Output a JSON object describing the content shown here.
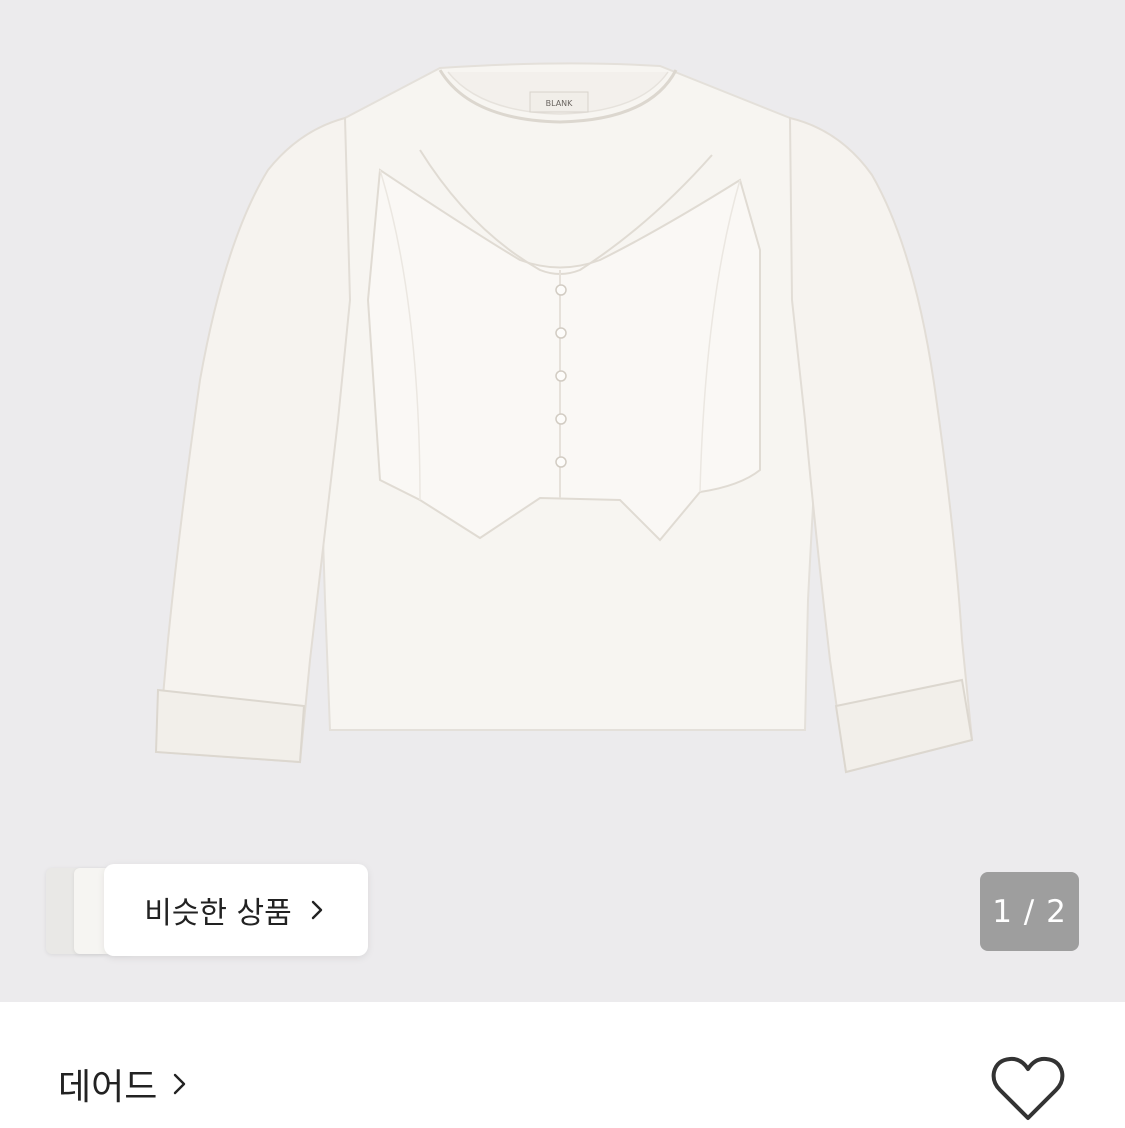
{
  "gallery": {
    "image_alt": "white long sleeve layered top with button vest",
    "label_text": "BLANK"
  },
  "similar": {
    "label": "비슷한 상품",
    "icon": "chevron-right-icon"
  },
  "pager": {
    "text": "1 / 2"
  },
  "brand": {
    "name": "데어드",
    "icon": "chevron-right-icon"
  },
  "wishlist": {
    "icon": "heart-outline-icon"
  },
  "colors": {
    "gallery_bg": "#ecebed",
    "garment": "#f7f5f1",
    "pager_bg": "#8c8c8c",
    "text": "#222222"
  }
}
